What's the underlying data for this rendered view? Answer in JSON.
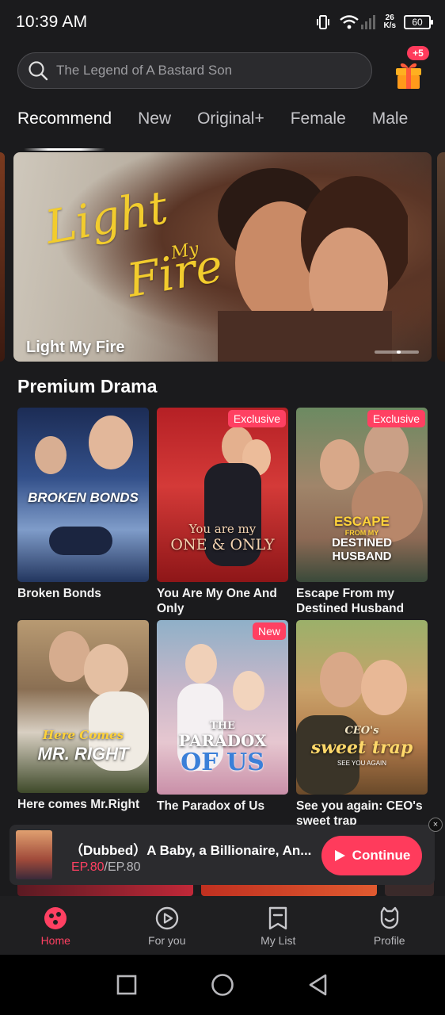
{
  "status_bar": {
    "time": "10:39 AM",
    "speed_value": "26",
    "speed_unit": "K/s",
    "battery": "60"
  },
  "search": {
    "placeholder": "The Legend of A Bastard Son"
  },
  "gift": {
    "badge": "+5"
  },
  "tabs": [
    {
      "label": "Recommend",
      "active": true
    },
    {
      "label": "New"
    },
    {
      "label": "Original+"
    },
    {
      "label": "Female"
    },
    {
      "label": "Male"
    }
  ],
  "banner": {
    "logo_line1": "Light",
    "logo_line2": "My",
    "logo_line3": "Fire",
    "title": "Light My Fire"
  },
  "section": {
    "title": "Premium Drama"
  },
  "dramas": [
    {
      "title": "Broken Bonds",
      "poster_text": "BROKEN BONDS",
      "tag": ""
    },
    {
      "title": "You Are My One And Only",
      "poster_text_1": "You are my",
      "poster_text_2": "ONE & ONLY",
      "tag": "Exclusive"
    },
    {
      "title": "Escape From my Destined Husband",
      "poster_text_1": "ESCAPE",
      "poster_text_2": "FROM MY",
      "poster_text_3": "DESTINED HUSBAND",
      "tag": "Exclusive"
    },
    {
      "title": "Here comes Mr.Right",
      "poster_text_1": "Here Comes",
      "poster_text_2": "MR. RIGHT",
      "tag": ""
    },
    {
      "title": "The Paradox of Us",
      "poster_text_1": "THE",
      "poster_text_2": "PARADOX",
      "poster_text_3": "OF US",
      "tag": "New"
    },
    {
      "title": "See you again: CEO's sweet trap",
      "poster_text_1": "CEO's",
      "poster_text_2": "sweet trap",
      "poster_text_3": "SEE YOU AGAIN",
      "tag": ""
    }
  ],
  "continue": {
    "title": "（Dubbed）A Baby, a Billionaire, An...",
    "ep_current": "EP.80",
    "ep_total": "/EP.80",
    "button": "Continue",
    "close": "×"
  },
  "bottom_nav": [
    {
      "label": "Home",
      "active": true
    },
    {
      "label": "For you"
    },
    {
      "label": "My List"
    },
    {
      "label": "Profile"
    }
  ],
  "colors": {
    "accent": "#ff3b5c",
    "background": "#1b1b1d"
  }
}
